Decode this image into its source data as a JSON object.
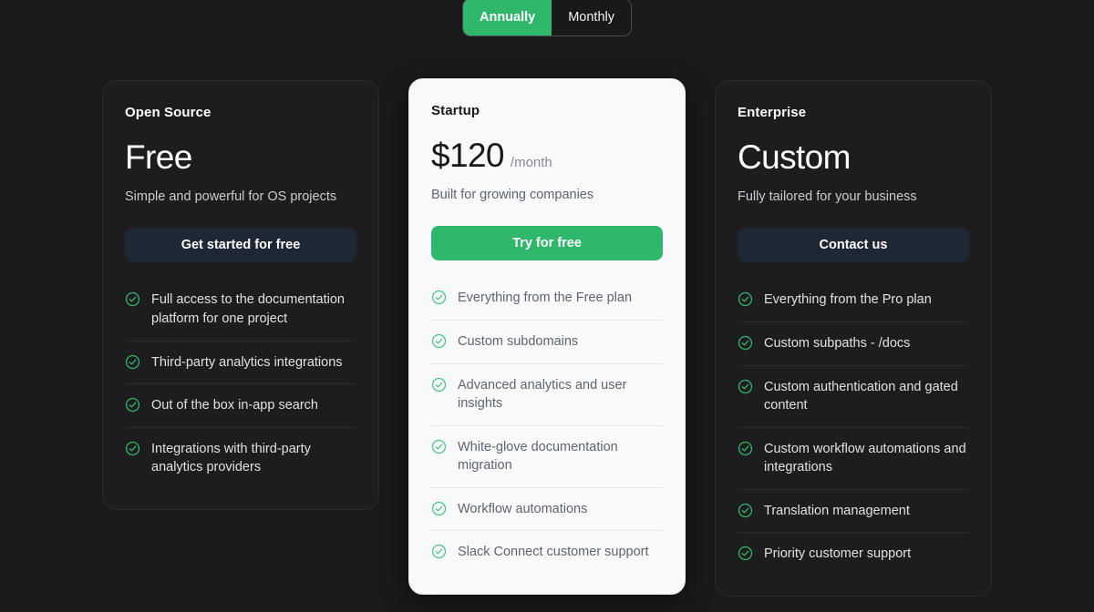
{
  "billing_toggle": {
    "options": [
      {
        "label": "Annually",
        "active": true
      },
      {
        "label": "Monthly",
        "active": false
      }
    ]
  },
  "colors": {
    "page_background": "#1a1a1c",
    "card_dark_background": "#1d1d20",
    "card_light_background": "#f8f9fa",
    "accent_green": "#2fb86c",
    "button_navy": "#1e2734",
    "check_green": "#2fb86c"
  },
  "check_icon_name": "check-circle-icon",
  "plans": [
    {
      "name": "Open Source",
      "price": "Free",
      "period": "",
      "tagline": "Simple and powerful for OS projects",
      "cta_label": "Get started for free",
      "cta_style": "navy",
      "theme": "dark",
      "featured": false,
      "features": [
        "Full access to the documentation platform for one project",
        "Third-party analytics integrations",
        "Out of the box in-app search",
        "Integrations with third-party analytics providers"
      ]
    },
    {
      "name": "Startup",
      "price": "$120",
      "period": "/month",
      "tagline": "Built for growing companies",
      "cta_label": "Try for free",
      "cta_style": "green",
      "theme": "light",
      "featured": true,
      "features": [
        "Everything from the Free plan",
        "Custom subdomains",
        "Advanced analytics and user insights",
        "White-glove documentation migration",
        "Workflow automations",
        "Slack Connect customer support"
      ]
    },
    {
      "name": "Enterprise",
      "price": "Custom",
      "period": "",
      "tagline": "Fully tailored for your business",
      "cta_label": "Contact us",
      "cta_style": "navy",
      "theme": "dark",
      "featured": false,
      "features": [
        "Everything from the Pro plan",
        "Custom subpaths - /docs",
        "Custom authentication and gated content",
        "Custom workflow automations and integrations",
        "Translation management",
        "Priority customer support"
      ]
    }
  ]
}
